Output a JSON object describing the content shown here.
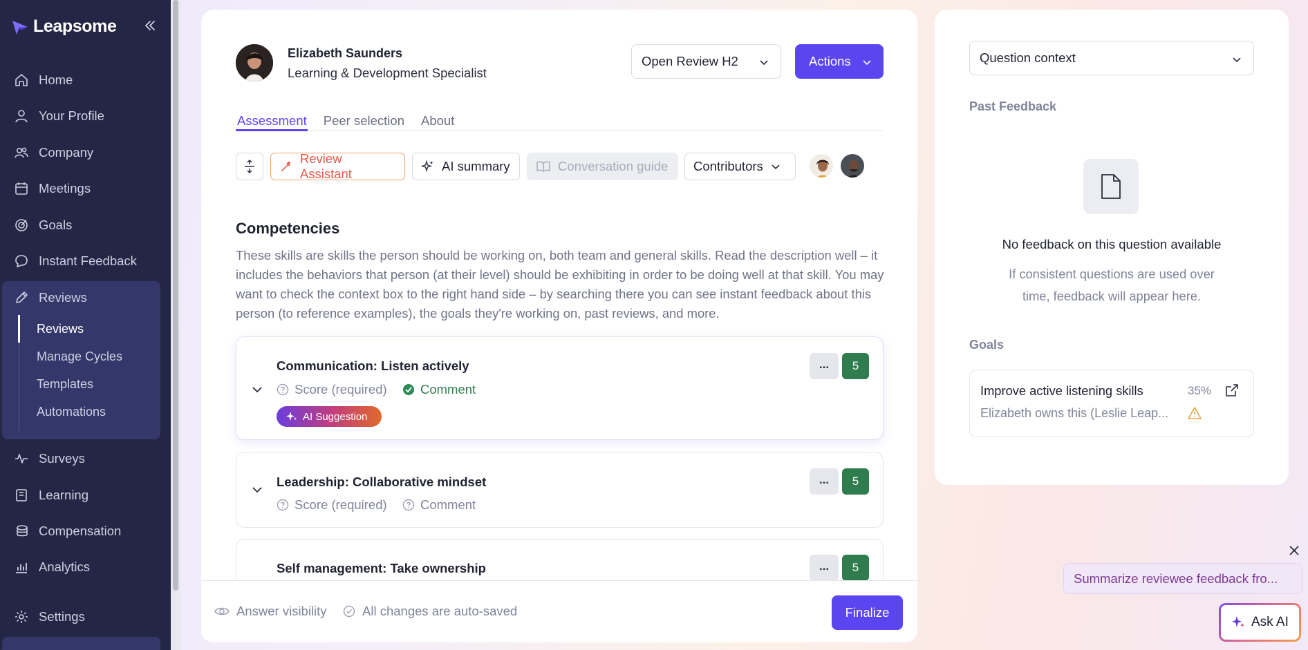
{
  "app": {
    "brand": "Leapsome"
  },
  "sidebar": {
    "items": [
      {
        "label": "Home",
        "icon": "home-icon"
      },
      {
        "label": "Your Profile",
        "icon": "user-icon"
      },
      {
        "label": "Company",
        "icon": "users-icon"
      },
      {
        "label": "Meetings",
        "icon": "calendar-icon"
      },
      {
        "label": "Goals",
        "icon": "target-icon"
      },
      {
        "label": "Instant Feedback",
        "icon": "chat-icon"
      },
      {
        "label": "Reviews",
        "icon": "pencil-icon"
      },
      {
        "label": "Surveys",
        "icon": "pulse-icon"
      },
      {
        "label": "Learning",
        "icon": "book-icon"
      },
      {
        "label": "Compensation",
        "icon": "coins-icon"
      },
      {
        "label": "Analytics",
        "icon": "chart-icon"
      },
      {
        "label": "Settings",
        "icon": "gear-icon"
      }
    ],
    "reviews_sub": [
      "Reviews",
      "Manage Cycles",
      "Templates",
      "Automations"
    ]
  },
  "review": {
    "person_name": "Elizabeth Saunders",
    "person_role": "Learning & Development Specialist",
    "cycle_select": "Open Review H2",
    "actions_label": "Actions",
    "tabs": [
      "Assessment",
      "Peer selection",
      "About"
    ],
    "toolbar": {
      "assistant": "Review Assistant",
      "ai_summary": "AI summary",
      "conversation_guide": "Conversation guide",
      "contributors": "Contributors"
    },
    "section_title": "Competencies",
    "section_desc": "These skills are skills the person should be working on, both team and general skills. Read the description well – it includes the behaviors that person (at their level) should be exhibiting in order to be doing well at that skill. You may want to check the context box to the right hand side – by searching there you can see instant feedback about this person (to reference examples), the goals they're working on, past reviews, and more.",
    "competencies": [
      {
        "title": "Communication: Listen actively",
        "score_label": "Score (required)",
        "comment_label": "Comment",
        "badge": "5",
        "more": "...",
        "ai_suggestion": "AI Suggestion"
      },
      {
        "title": "Leadership: Collaborative mindset",
        "score_label": "Score (required)",
        "comment_label": "Comment",
        "badge": "5",
        "more": "..."
      },
      {
        "title": "Self management: Take ownership",
        "badge": "5",
        "more": "..."
      }
    ],
    "footer": {
      "visibility": "Answer visibility",
      "autosave": "All changes are auto-saved",
      "finalize": "Finalize"
    }
  },
  "context_panel": {
    "select": "Question context",
    "past_feedback_label": "Past Feedback",
    "empty_title": "No feedback on this question available",
    "empty_desc": "If consistent questions are used over time, feedback will appear here.",
    "goals_label": "Goals",
    "goal": {
      "title": "Improve active listening skills",
      "progress": "35%",
      "owner": "Elizabeth owns this (Leslie Leap..."
    }
  },
  "ai_widget": {
    "suggestion": "Summarize reviewee feedback fro...",
    "ask_label": "Ask AI"
  },
  "colors": {
    "accent": "#5b45f0",
    "sidebar": "#242645",
    "score_green": "#2f7d4f"
  }
}
